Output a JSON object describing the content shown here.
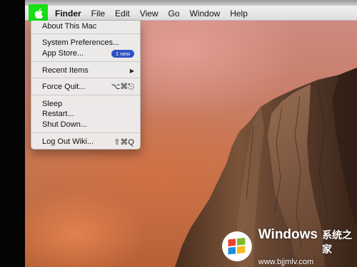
{
  "menubar": {
    "apple_icon": "apple-logo",
    "items": [
      {
        "label": "Finder"
      },
      {
        "label": "File"
      },
      {
        "label": "Edit"
      },
      {
        "label": "View"
      },
      {
        "label": "Go"
      },
      {
        "label": "Window"
      },
      {
        "label": "Help"
      }
    ]
  },
  "apple_menu": {
    "items": [
      {
        "label": "About This Mac"
      },
      {
        "label": "System Preferences..."
      },
      {
        "label": "App Store...",
        "badge": "1 new"
      },
      {
        "label": "Recent Items",
        "submenu_arrow": "▶"
      },
      {
        "label": "Force Quit...",
        "shortcut": "⌥⌘⎋"
      },
      {
        "label": "Sleep"
      },
      {
        "label": "Restart..."
      },
      {
        "label": "Shut Down..."
      },
      {
        "label": "Log Out Wiki...",
        "shortcut": "⇧⌘Q"
      }
    ]
  },
  "watermark": {
    "brand": "Windows",
    "cn": "系统之家",
    "url": "www.bjjmlv.com"
  },
  "colors": {
    "apple_highlight": "#17e014",
    "badge": "#2f52c4"
  }
}
